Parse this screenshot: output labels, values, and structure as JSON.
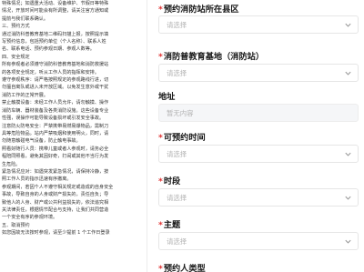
{
  "notice": {
    "lines": [
      "特殊情况；如遇重大活动、设备维护、节假日等特殊",
      "情况，开放时间可能会有所调整，请关注官方通知或",
      "提前与我们联系确认。",
      "三、预约方式",
      "通过消防科普教育基地二维码扫描上报，按照提示填",
      "写预约信息，包括预约单位（个人名称）、联系人姓",
      "名、联系电话、预约参观日期、参观人数等。",
      "四、安全规定",
      "所有参观者必须遵守消防科普教育基地和消防救援站",
      "的各项安全规定，听从工作人员的指挥和安排。",
      "遵守参观秩序：请严格按照规定的参观路线行进，切",
      "勿擅自离队或进入未开放区域。以免发生意外或干扰",
      "消防工作的正常开展。",
      "禁止触摸设备：未经工作人员允许，请勿触摸、操作",
      "消防车辆、器材装备及各类消防设施。这些设备专业",
      "性强，误操作可能导致设备损坏或引发安全事故。",
      "注意防火防电安全：严禁携带易燃易爆物品，需制刀",
      "具等危险物品。站内严禁吸烟和使用明火，同时，请",
      "勿随意触碰电气设备，防止触电事故。",
      "照看好随行人员：携带儿童或者人参观时，请务必全",
      "程陪同照看，避免其因好奇，打闹或其他不当行为发",
      "生危险。",
      "紧急情况应对：如遇突发紧急情况，请保持冷静，按",
      "照工作人员的指示迅速有序撤离。",
      "参观期间，若因个人不遵守相关规定或造成的自身安全",
      "事故，导致自身的人身或财产损失的，责任自负；导",
      "致他人的人身、财产或公共利益损失的，依法追究相",
      "关法律责任，根据情节配合与支持，让我们共同营造",
      "一个安全有序的参观环境。",
      "五、取消预约",
      "如您因故无法按时参观，请至少提前 1 个工作日登录"
    ]
  },
  "form": {
    "station_district": {
      "label": "预约消防站所在县区",
      "placeholder": "请选择"
    },
    "base_name": {
      "label": "消防普教育基地（消防站）",
      "placeholder": "请选择"
    },
    "address": {
      "label": "地址",
      "placeholder": "暂无内容"
    },
    "visit_time": {
      "label": "可预约时间",
      "placeholder": "请选择"
    },
    "time_slot": {
      "label": "时段",
      "placeholder": "请选择"
    },
    "topic": {
      "label": "主题",
      "placeholder": "请选择"
    },
    "visitor_type": {
      "label": "预约人类型"
    }
  },
  "required_mark": "*",
  "colors": {
    "required": "#e03030",
    "placeholder": "#b3b3b3",
    "border": "#e6e6e6"
  },
  "icons": {
    "dropdown": "chevron-down-icon"
  }
}
